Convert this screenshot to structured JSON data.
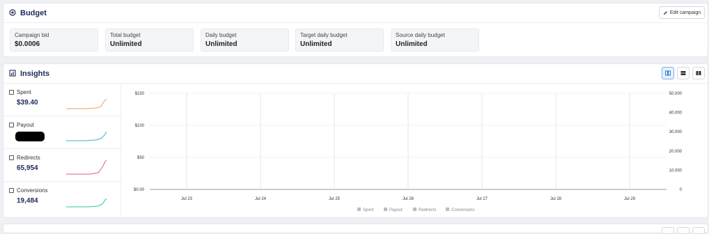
{
  "budget": {
    "title": "Budget",
    "edit_label": "Edit campaign",
    "stats": [
      {
        "label": "Campaign bid",
        "value": "$0.0006"
      },
      {
        "label": "Total budget",
        "value": "Unlimited"
      },
      {
        "label": "Daily budget",
        "value": "Unlimited"
      },
      {
        "label": "Target daily budget",
        "value": "Unlimited"
      },
      {
        "label": "Source daily budget",
        "value": "Unlimited"
      }
    ]
  },
  "insights": {
    "title": "Insights",
    "metrics": [
      {
        "label": "Spent",
        "value": "$39.40",
        "color": "#f39c5a",
        "redacted": false
      },
      {
        "label": "Payout",
        "value": "",
        "color": "#2bb3d9",
        "redacted": true
      },
      {
        "label": "Redirects",
        "value": "65,954",
        "color": "#e5587a",
        "redacted": false
      },
      {
        "label": "Conversions",
        "value": "19,484",
        "color": "#2ecc8f",
        "redacted": false
      }
    ]
  },
  "chart_data": {
    "type": "line",
    "x": [
      "Jul 23",
      "Jul 24",
      "Jul 25",
      "Jul 26",
      "Jul 27",
      "Jul 28",
      "Jul 29"
    ],
    "y_left_ticks": [
      "$0.00",
      "$50",
      "$100",
      "$150"
    ],
    "y_right_ticks": [
      "0",
      "10.000",
      "20.000",
      "30.000",
      "40.000",
      "50.000"
    ],
    "ylim_left": [
      0,
      150
    ],
    "ylim_right": [
      0,
      50000
    ],
    "legend": [
      "Spent",
      "Payout",
      "Redirects",
      "Conversions"
    ],
    "legend_placement": "bottom",
    "grid": true
  },
  "colors": {
    "accent": "#1c2a5a",
    "active_view": "#2b7bd9",
    "legend_swatch": "#b9bcc4"
  }
}
